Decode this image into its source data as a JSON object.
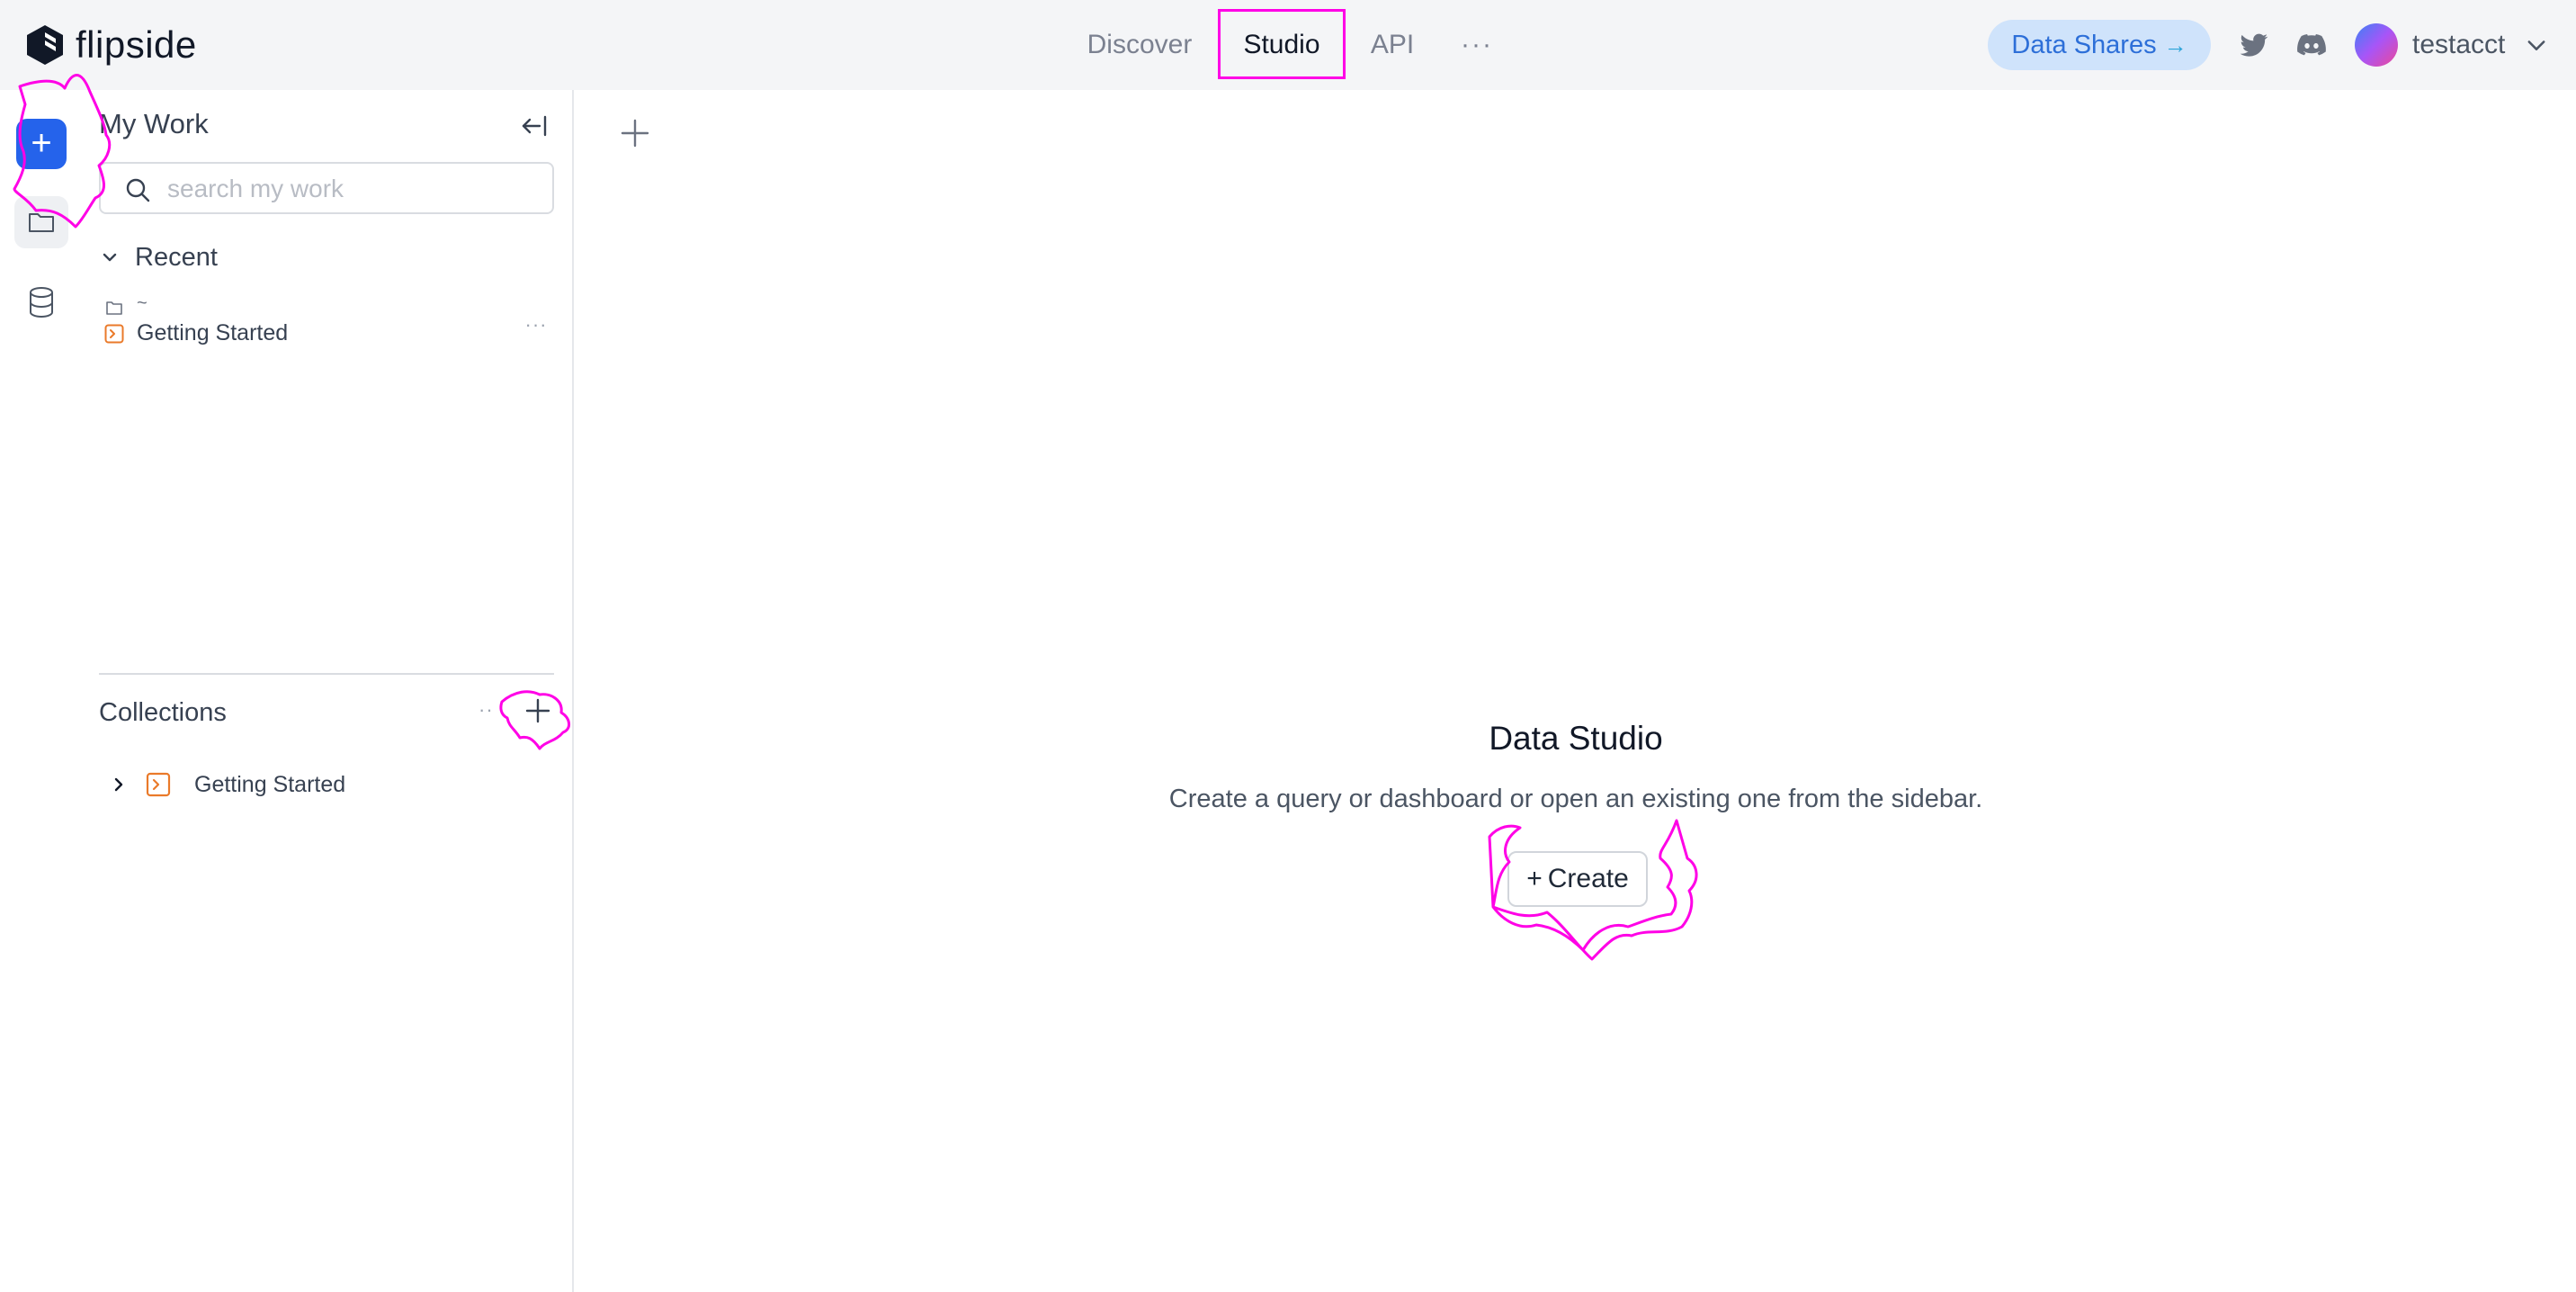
{
  "header": {
    "brand": "flipside",
    "nav": [
      "Discover",
      "Studio",
      "API",
      "···"
    ],
    "data_shares": "Data Shares",
    "data_shares_arrow": "→",
    "username": "testacct"
  },
  "rail": {
    "add_label": "+"
  },
  "sidebar": {
    "title": "My Work",
    "search_placeholder": "search my work",
    "recent_label": "Recent",
    "recent_items": [
      {
        "path": "~",
        "name": "Getting Started",
        "more": "···"
      }
    ],
    "collections_title": "Collections",
    "collections_more": "··",
    "collections": [
      {
        "name": "Getting Started"
      }
    ]
  },
  "main": {
    "title": "Data Studio",
    "description": "Create a query or dashboard or open an existing one from the sidebar.",
    "create_plus": "+",
    "create_label": "Create"
  },
  "colors": {
    "accent_blue": "#2563eb",
    "annotation_magenta": "#ff00e6",
    "query_icon_orange": "#ea7a2a",
    "data_shares_bg": "#cfe3fb"
  },
  "icons": [
    "flipside-logo-icon",
    "twitter-icon",
    "discord-icon",
    "chevron-down-icon",
    "plus-icon",
    "folder-icon",
    "database-icon",
    "collapse-sidebar-icon",
    "search-icon",
    "query-icon",
    "chevron-right-icon"
  ]
}
